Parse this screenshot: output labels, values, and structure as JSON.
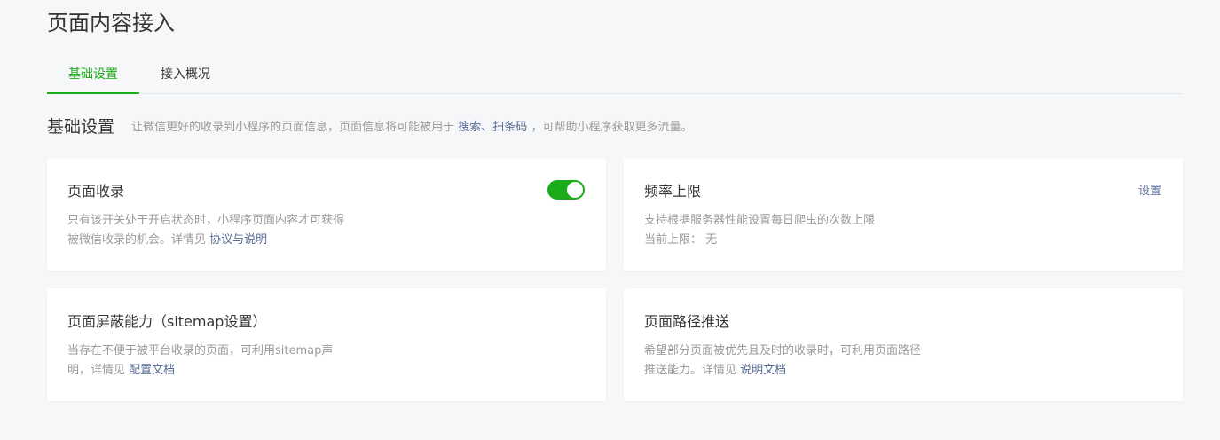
{
  "page": {
    "title": "页面内容接入"
  },
  "tabs": [
    {
      "label": "基础设置",
      "active": true
    },
    {
      "label": "接入概况",
      "active": false
    }
  ],
  "section": {
    "title": "基础设置",
    "desc_prefix": "让微信更好的收录到小程序的页面信息，页面信息将可能被用于",
    "desc_highlight_1": "搜索",
    "desc_sep": "、",
    "desc_highlight_2": "扫条码",
    "desc_suffix": "，可帮助小程序获取更多流量。"
  },
  "cards": {
    "page_index": {
      "title": "页面收录",
      "desc_line1": "只有该开关处于开启状态时，小程序页面内容才可获得",
      "desc_line2_prefix": "被微信收录的机会。详情见",
      "desc_link": "协议与说明",
      "toggle_on": true
    },
    "rate_limit": {
      "title": "频率上限",
      "action": "设置",
      "desc_line1": "支持根据服务器性能设置每日爬虫的次数上限",
      "desc_line2_label": "当前上限：",
      "desc_line2_value": "无"
    },
    "sitemap": {
      "title": "页面屏蔽能力（sitemap设置）",
      "desc_line1": "当存在不便于被平台收录的页面，可利用sitemap声",
      "desc_line2_prefix": "明，详情见",
      "desc_link": "配置文档"
    },
    "path_push": {
      "title": "页面路径推送",
      "desc_line1": "希望部分页面被优先且及时的收录时，可利用页面路径",
      "desc_line2_prefix": "推送能力。详情见",
      "desc_link": "说明文档"
    }
  },
  "colors": {
    "accent_green": "#1aad19",
    "link_blue": "#576b95",
    "background": "#f6f7f9"
  }
}
